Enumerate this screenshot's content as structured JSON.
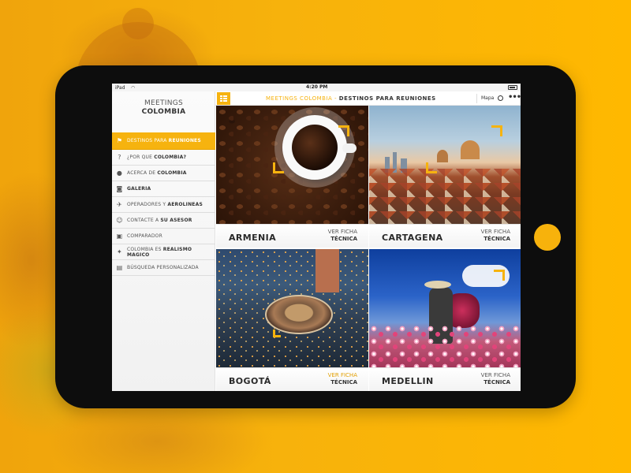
{
  "status_bar": {
    "device": "iPad",
    "time": "4:20 PM"
  },
  "brand": {
    "line1": "MEETINGS",
    "line2": "COLOMBIA"
  },
  "menu": [
    {
      "pre": "DESTINOS PARA ",
      "bold": "REUNIONES",
      "icon": "map-marker-icon",
      "active": true
    },
    {
      "pre": "¿POR QUE ",
      "bold": "COLOMBIA?",
      "icon": "question-icon"
    },
    {
      "pre": "ACERCA DE ",
      "bold": "COLOMBIA",
      "icon": "info-icon"
    },
    {
      "pre": "",
      "bold": "GALERIA",
      "icon": "camera-icon"
    },
    {
      "pre": "OPERADORES Y ",
      "bold": "AEROLINEAS",
      "icon": "plane-icon"
    },
    {
      "pre": "CONTACTE A ",
      "bold": "SU ASESOR",
      "icon": "person-icon"
    },
    {
      "pre": "COMPARADOR",
      "bold": "",
      "icon": "compare-icon"
    },
    {
      "pre": "COLOMBIA ES ",
      "bold": "REALISMO MAGICO",
      "icon": "bird-icon"
    },
    {
      "pre": "BÚSQUEDA PERSONALIZADA",
      "bold": "",
      "icon": "search-list-icon"
    }
  ],
  "topbar": {
    "title_pre": "MEETINGS COLOMBIA - ",
    "title_bold": "DESTINOS PARA REUNIONES",
    "mapa": "Mapa",
    "more": "•••"
  },
  "tiles": [
    {
      "city": "ARMENIA",
      "ficha1": "VER FICHA",
      "ficha2": "TÉCNICA"
    },
    {
      "city": "CARTAGENA",
      "ficha1": "VER FICHA",
      "ficha2": "TÉCNICA"
    },
    {
      "city": "BOGOTÁ",
      "ficha1": "VER FICHA",
      "ficha2": "TÉCNICA"
    },
    {
      "city": "MEDELLIN",
      "ficha1": "VER FICHA",
      "ficha2": "TÉCNICA"
    }
  ],
  "colors": {
    "accent": "#f6b30f",
    "tablet": "#0d0d0d",
    "background": "#f5ae0c"
  }
}
